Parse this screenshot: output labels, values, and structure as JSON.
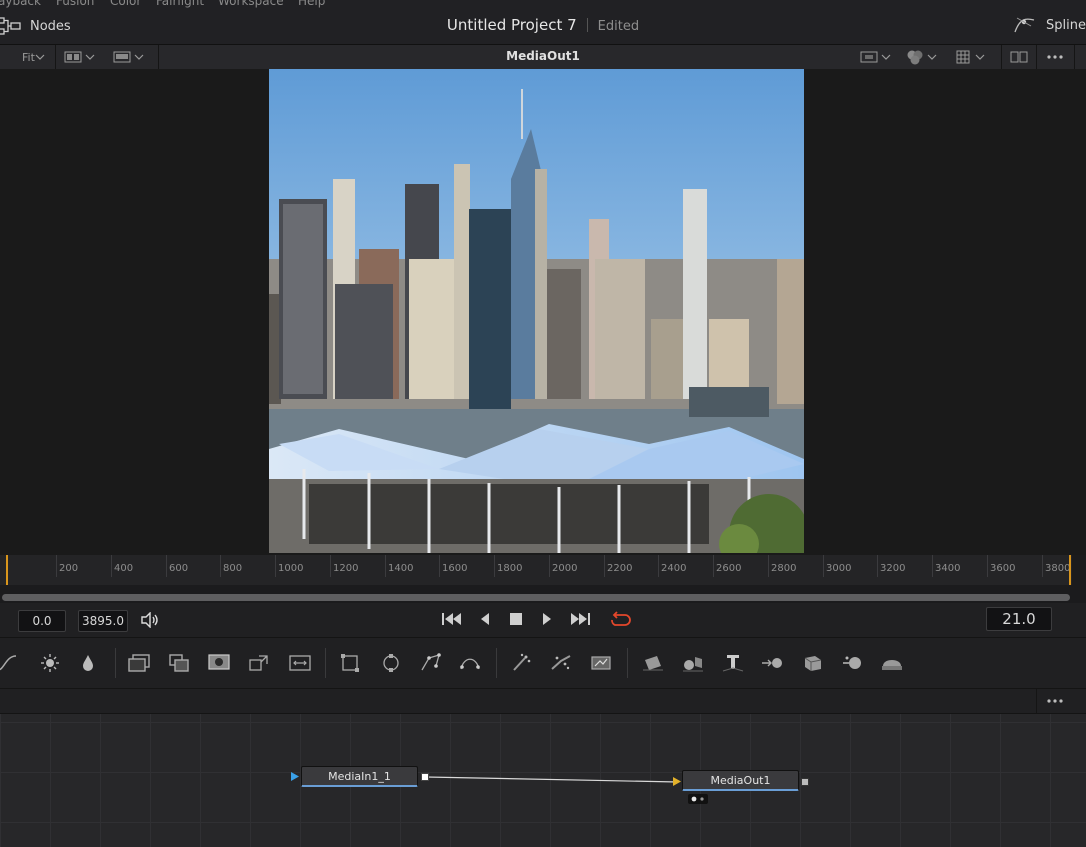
{
  "menu": {
    "items": [
      "ayback",
      "Fusion",
      "Color",
      "Fairlight",
      "Workspace",
      "Help"
    ]
  },
  "header": {
    "nodes_tab": "Nodes",
    "project_title": "Untitled Project 7",
    "project_status": "Edited",
    "spline_tab": "Spline"
  },
  "viewer_toolbar": {
    "fit_label": "Fit",
    "viewer_name": "MediaOut1"
  },
  "timeline": {
    "ticks": [
      "200",
      "400",
      "600",
      "800",
      "1000",
      "1200",
      "1400",
      "1600",
      "1800",
      "2000",
      "2200",
      "2400",
      "2600",
      "2800",
      "3000",
      "3200",
      "3400",
      "3600",
      "3800"
    ]
  },
  "transport": {
    "start": "0.0",
    "end": "3895.0",
    "current_frame": "21.0"
  },
  "nodes": {
    "media_in": "MediaIn1_1",
    "media_out": "MediaOut1"
  },
  "colors": {
    "accent": "#d8951c",
    "loop": "#e3472b",
    "node_highlight": "#6a9ed6"
  }
}
